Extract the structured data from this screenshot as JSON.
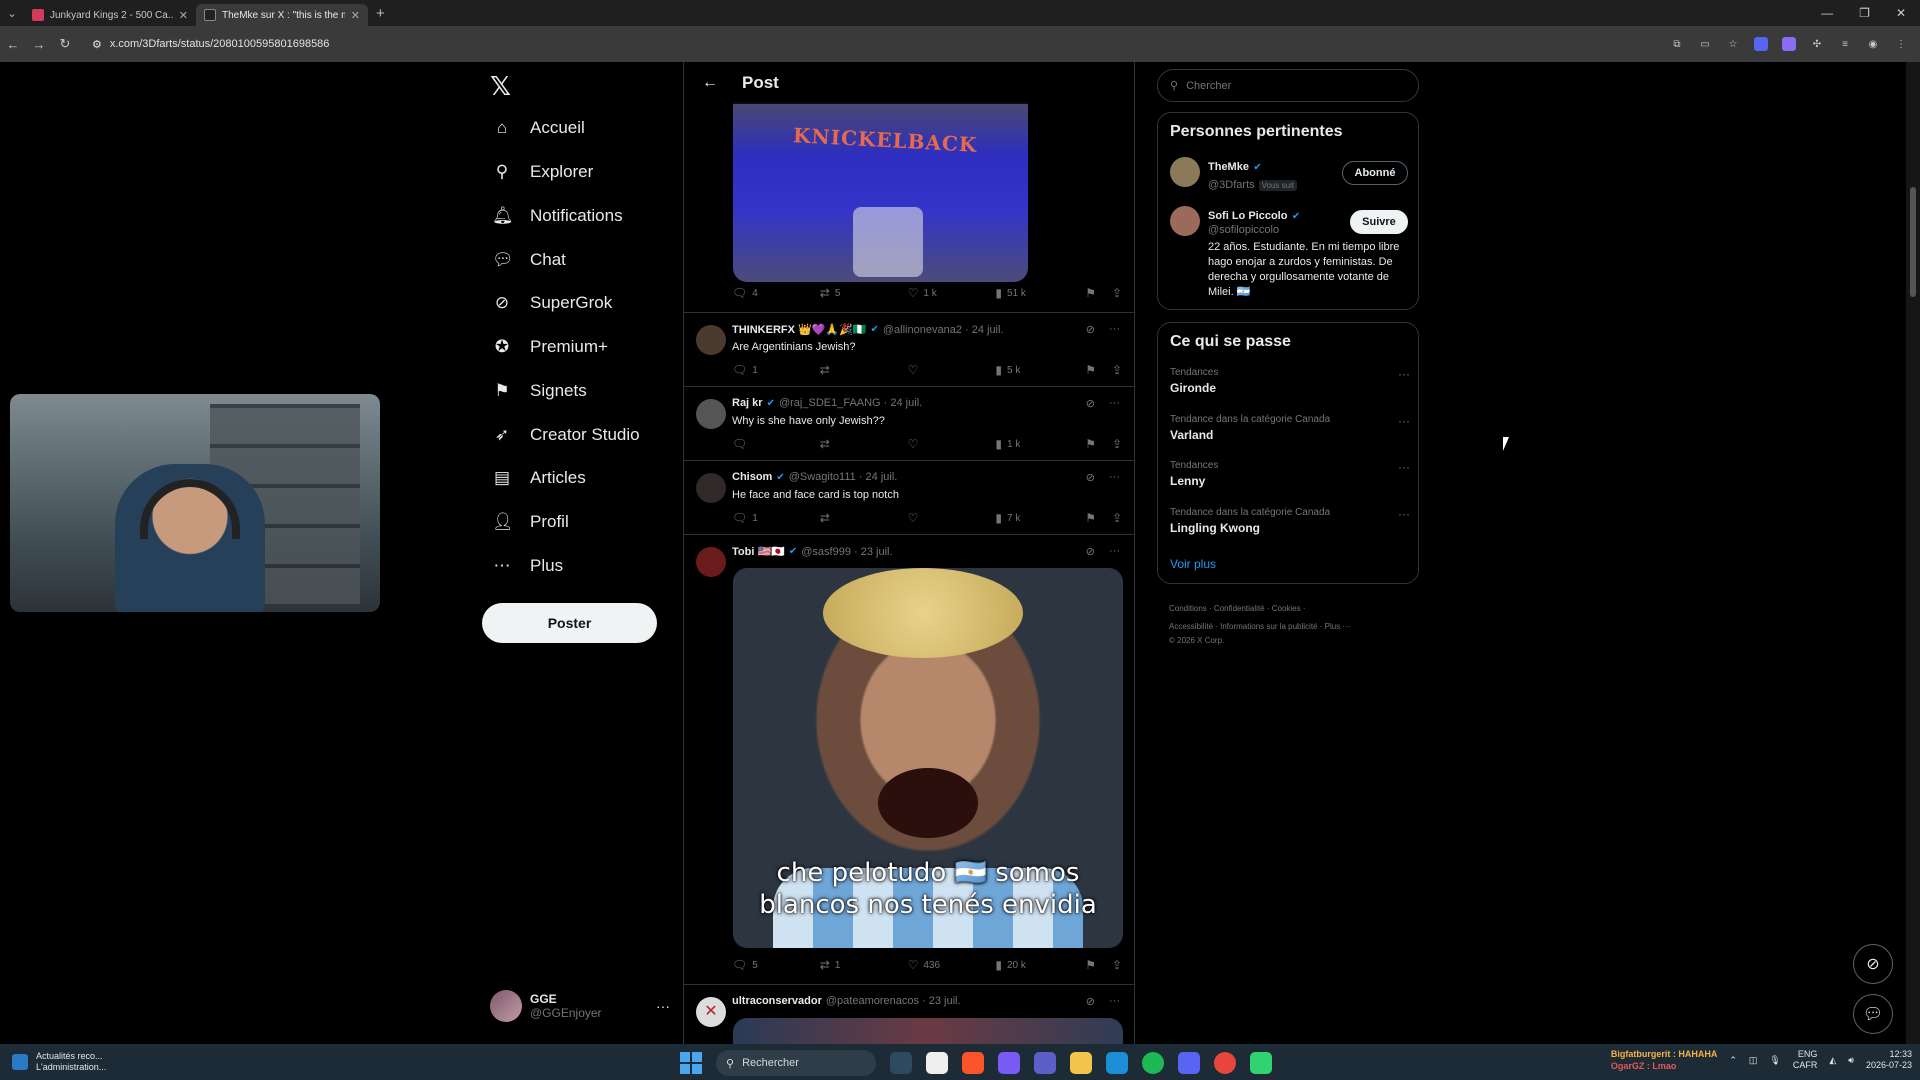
{
  "browser": {
    "tabs": [
      {
        "title": "Junkyard Kings 2 - 500 Ca...",
        "favicon_color": "#d33b5a",
        "active": false
      },
      {
        "title": "TheMke sur X : \"this is the mo...",
        "favicon_color": "#222222",
        "active": true
      }
    ],
    "new_tab": "+",
    "url": "x.com/3Dfarts/status/2080100595801698586"
  },
  "nav": {
    "logo": "𝕏",
    "items": [
      {
        "label": "Accueil",
        "icon": "home-icon",
        "glyph": "⌂"
      },
      {
        "label": "Explorer",
        "icon": "search-icon",
        "glyph": "⚲"
      },
      {
        "label": "Notifications",
        "icon": "bell-icon",
        "glyph": "🔔︎"
      },
      {
        "label": "Chat",
        "icon": "chat-icon",
        "glyph": "💬︎"
      },
      {
        "label": "SuperGrok",
        "icon": "grok-icon",
        "glyph": "⊘"
      },
      {
        "label": "Premium+",
        "icon": "premium-icon",
        "glyph": "✪"
      },
      {
        "label": "Signets",
        "icon": "bookmark-icon",
        "glyph": "⚑"
      },
      {
        "label": "Creator Studio",
        "icon": "creator-icon",
        "glyph": "➶"
      },
      {
        "label": "Articles",
        "icon": "articles-icon",
        "glyph": "▤"
      },
      {
        "label": "Profil",
        "icon": "profile-icon",
        "glyph": "👤︎"
      },
      {
        "label": "Plus",
        "icon": "more-icon",
        "glyph": "⋯"
      }
    ],
    "post_button": "Poster",
    "account": {
      "name": "GGE",
      "handle": "@GGEnjoyer",
      "more": "···"
    }
  },
  "post": {
    "header_title": "Post",
    "media1_text": "KNICKELBACK",
    "main_actions": {
      "replies": "4",
      "reposts": "5",
      "likes": "1 k",
      "views": "51 k"
    },
    "replies": [
      {
        "name": "THINKERFX 👑💜🙏🎉🇳🇬",
        "handle": "@allinonevana2 · 24 juil.",
        "text": "Are Argentinians Jewish?",
        "replies": "1",
        "reposts": "",
        "likes": "",
        "views": "5 k",
        "avatar": "#4a3a30"
      },
      {
        "name": "Raj kr",
        "handle": "@raj_SDE1_FAANG · 24 juil.",
        "text": "Why is she have only Jewish??",
        "replies": "",
        "reposts": "",
        "likes": "",
        "views": "1 k",
        "avatar": "#555555"
      },
      {
        "name": "Chisom",
        "handle": "@Swagito111 · 24 juil.",
        "text": "He face and face card is top notch",
        "replies": "1",
        "reposts": "",
        "likes": "",
        "views": "7 k",
        "avatar": "#2f2a28"
      },
      {
        "name": "Tobi 🇺🇸🇯🇵",
        "handle": "@sasf999 · 23 juil.",
        "text": "",
        "replies": "5",
        "reposts": "1",
        "likes": "436",
        "views": "20 k",
        "avatar": "#6b1b1b"
      },
      {
        "name": "ultraconservador",
        "handle": "@pateamorenacos · 23 juil.",
        "text": "",
        "replies": "",
        "reposts": "",
        "likes": "",
        "views": "",
        "avatar": "#dddddd"
      }
    ],
    "meme_caption_line1": "che pelotudo 🇦🇷 somos",
    "meme_caption_line2": "blancos nos tenés envidia"
  },
  "right": {
    "search_placeholder": "Chercher",
    "people_title": "Personnes pertinentes",
    "people": [
      {
        "name": "TheMke",
        "handle": "@3Dfarts",
        "tag": "Vous suit",
        "button": "Abonné",
        "bio": ""
      },
      {
        "name": "Sofi Lo Piccolo",
        "handle": "@sofilopiccolo",
        "tag": "",
        "button": "Suivre",
        "bio": "22 años. Estudiante. En mi tiempo libre hago enojar a zurdos y feministas. De derecha y orgullosamente votante de Milei. 🇦🇷"
      }
    ],
    "trends_title": "Ce qui se passe",
    "trends": [
      {
        "category": "Tendances",
        "title": "Gironde"
      },
      {
        "category": "Tendance dans la catégorie Canada",
        "title": "Varland"
      },
      {
        "category": "Tendances",
        "title": "Lenny"
      },
      {
        "category": "Tendance dans la catégorie Canada",
        "title": "Lingling Kwong"
      }
    ],
    "see_more": "Voir plus",
    "footer_line1": "Conditions · Confidentialité · Cookies ·",
    "footer_line2": "Accessibilité · Informations sur la publicité · Plus ···",
    "footer_line3": "© 2026 X Corp."
  },
  "taskbar": {
    "news_line1": "Actualités reco...",
    "news_line2": "L'administration...",
    "search": "Rechercher",
    "notif_user1": "Bigfatburgerit : HAHAHA",
    "notif_user2": "OgarGZ : Lmao",
    "lang1": "ENG",
    "lang2": "CAFR",
    "time": "12:33",
    "date": "2026-07-23"
  }
}
